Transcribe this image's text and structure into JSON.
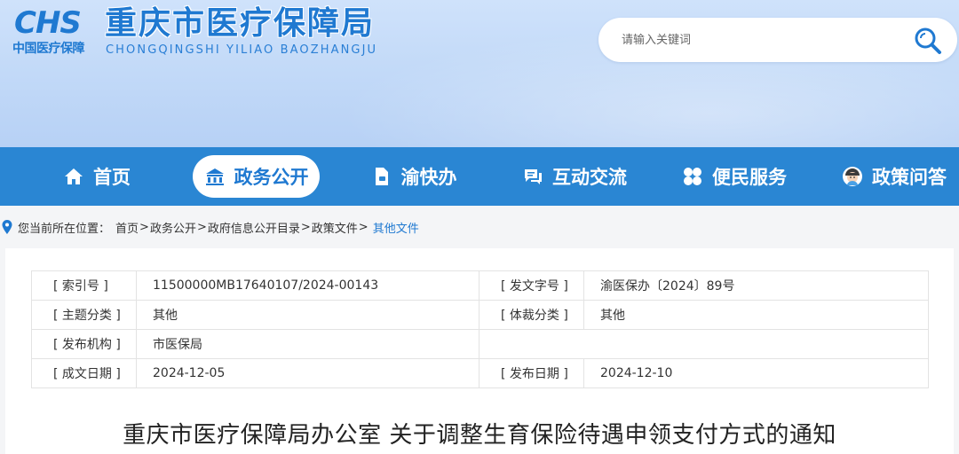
{
  "header": {
    "logo_text": "CHS",
    "logo_sub": "中国医疗保障",
    "title": "重庆市医疗保障局",
    "subtitle": "CHONGQINGSHI  YILIAO  BAOZHANGJU"
  },
  "search": {
    "placeholder": "请输入关键词",
    "icon": "search-icon"
  },
  "nav": {
    "items": [
      {
        "label": "首页",
        "icon": "home-icon"
      },
      {
        "label": "政务公开",
        "icon": "building-icon",
        "active": true
      },
      {
        "label": "渝快办",
        "icon": "document-icon"
      },
      {
        "label": "互动交流",
        "icon": "chat-icon"
      },
      {
        "label": "便民服务",
        "icon": "clover-icon"
      },
      {
        "label": "政策问答",
        "icon": "avatar-icon"
      }
    ]
  },
  "breadcrumb": {
    "prefix": "您当前所在位置：",
    "items": [
      "首页",
      "政务公开",
      "政府信息公开目录",
      "政策文件"
    ],
    "current": "其他文件"
  },
  "meta": {
    "rows": [
      {
        "l1": "[ 索引号 ]",
        "v1": "11500000MB17640107/2024-00143",
        "l2": "[ 发文字号 ]",
        "v2": "渝医保办〔2024〕89号"
      },
      {
        "l1": "[ 主题分类 ]",
        "v1": "其他",
        "l2": "[ 体裁分类 ]",
        "v2": "其他"
      },
      {
        "l1": "[ 发布机构 ]",
        "v1": "市医保局",
        "l2": "",
        "v2": ""
      },
      {
        "l1": "[ 成文日期 ]",
        "v1": "2024-12-05",
        "l2": "[ 发布日期 ]",
        "v2": "2024-12-10"
      }
    ]
  },
  "document": {
    "title": "重庆市医疗保障局办公室 关于调整生育保险待遇申领支付方式的通知"
  },
  "colors": {
    "brand_blue": "#1f79d1",
    "nav_bg": "#2a86d3",
    "header_bg": "#c3daf8"
  }
}
